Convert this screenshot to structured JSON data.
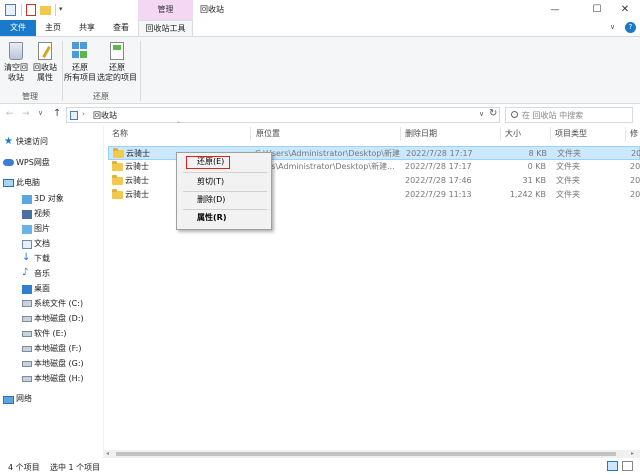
{
  "window": {
    "title": "回收站",
    "context_tab": "管理",
    "minimize_glyph": "—",
    "maximize_glyph": "☐",
    "close_glyph": "✕"
  },
  "tabs": {
    "file": "文件",
    "home": "主页",
    "share": "共享",
    "view": "查看",
    "recycle_tools": "回收站工具"
  },
  "ribbon": {
    "empty_label": "清空回\n收站",
    "properties_label": "回收站\n属性",
    "restore_all_label": "还原\n所有项目",
    "restore_selected_label": "还原\n选定的项目",
    "group_manage": "管理",
    "group_restore": "还原"
  },
  "address": {
    "path": "回收站",
    "search_placeholder": "在 回收站 中搜索"
  },
  "nav": {
    "quick_access": "快速访问",
    "wps": "WPS网盘",
    "this_pc": "此电脑",
    "items": [
      "3D 对象",
      "视频",
      "图片",
      "文档",
      "下载",
      "音乐",
      "桌面",
      "系统文件 (C:)",
      "本地磁盘 (D:)",
      "软件 (E:)",
      "本地磁盘 (F:)",
      "本地磁盘 (G:)",
      "本地磁盘 (H:)"
    ],
    "network": "网络"
  },
  "columns": {
    "name": "名称",
    "location": "原位置",
    "date": "删除日期",
    "size": "大小",
    "type": "项目类型",
    "extra": "修"
  },
  "files": [
    {
      "name": "云骑士",
      "location": "C:\\Users\\Administrator\\Desktop\\新建...",
      "date": "2022/7/28 17:17",
      "size": "8 KB",
      "type": "文件夹",
      "extra": "20"
    },
    {
      "name": "云骑士",
      "location": "rs\\Administrator\\Desktop\\新建...",
      "date": "2022/7/28 17:17",
      "size": "0 KB",
      "type": "文件夹",
      "extra": "20"
    },
    {
      "name": "云骑士",
      "location": "",
      "date": "2022/7/28 17:46",
      "size": "31 KB",
      "type": "文件夹",
      "extra": "20"
    },
    {
      "name": "云骑士",
      "location": "",
      "date": "2022/7/29 11:13",
      "size": "1,242 KB",
      "type": "文件夹",
      "extra": "20"
    }
  ],
  "context_menu": {
    "restore": "还原(E)",
    "cut": "剪切(T)",
    "delete": "删除(D)",
    "properties": "属性(R)"
  },
  "status": {
    "count": "4 个项目",
    "selected": "选中 1 个项目"
  },
  "colors": {
    "accent": "#1979ca",
    "manage_tab": "#f3d7f3",
    "selection": "#cce8ff",
    "folder": "#f2c94c",
    "highlight_border": "#e02020"
  }
}
